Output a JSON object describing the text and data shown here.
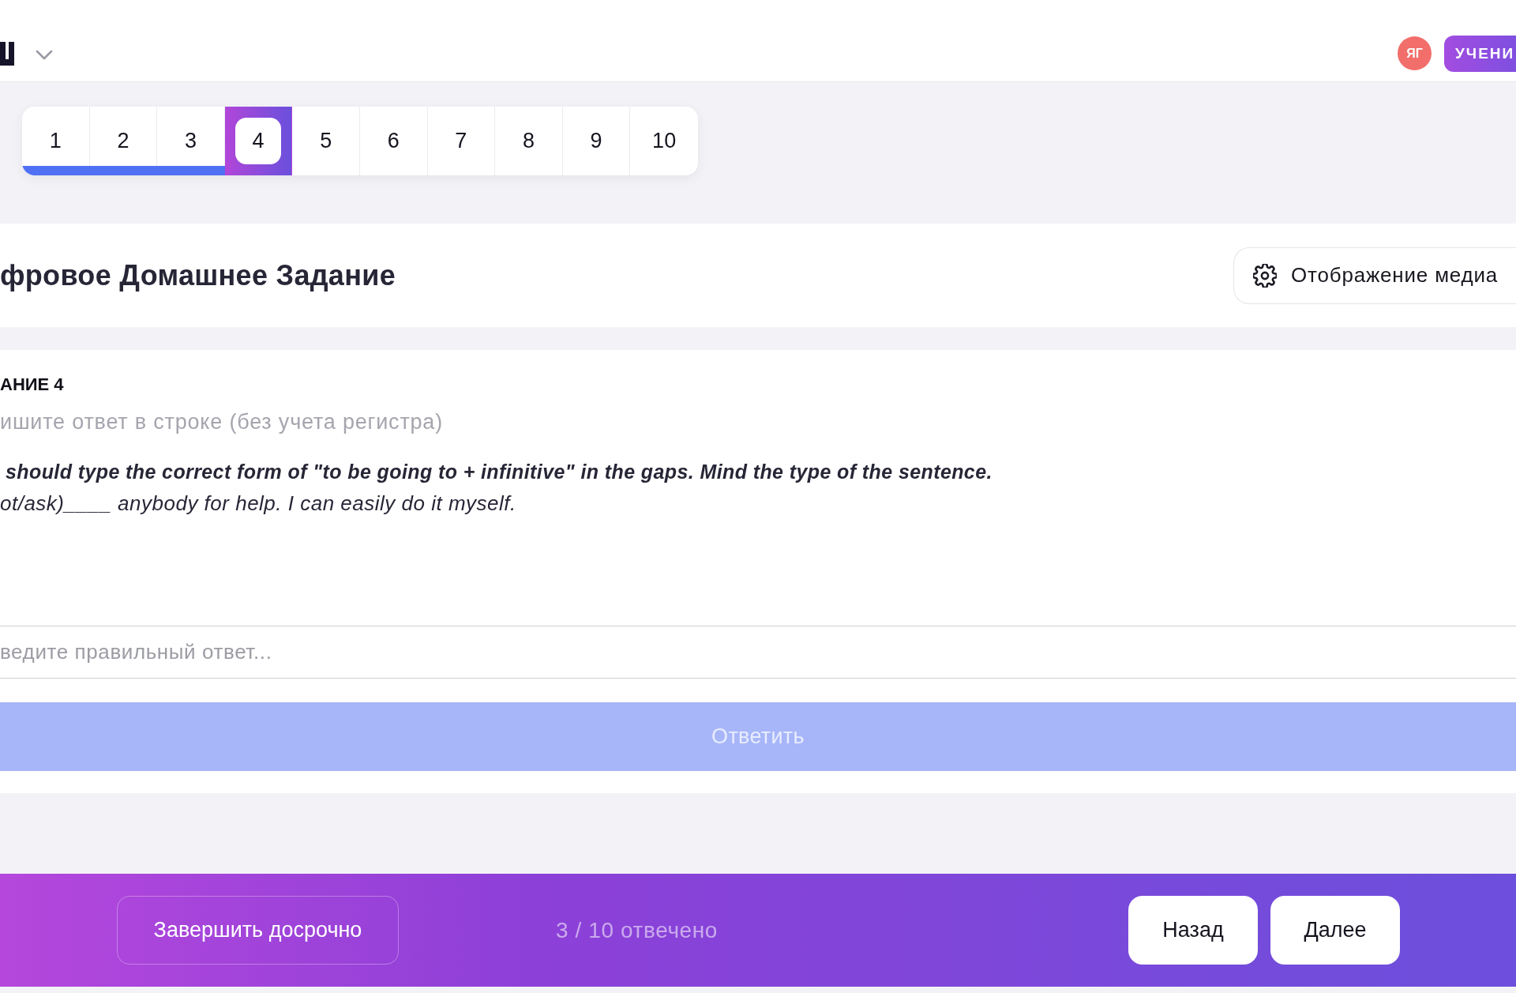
{
  "header": {
    "user": {
      "initials": "ЯГ"
    },
    "role_badge": "УЧЕНИ"
  },
  "questions": [
    {
      "label": "1",
      "answered": true,
      "selected": false
    },
    {
      "label": "2",
      "answered": true,
      "selected": false
    },
    {
      "label": "3",
      "answered": true,
      "selected": false
    },
    {
      "label": "4",
      "answered": false,
      "selected": true
    },
    {
      "label": "5",
      "answered": false,
      "selected": false
    },
    {
      "label": "6",
      "answered": false,
      "selected": false
    },
    {
      "label": "7",
      "answered": false,
      "selected": false
    },
    {
      "label": "8",
      "answered": false,
      "selected": false
    },
    {
      "label": "9",
      "answered": false,
      "selected": false
    },
    {
      "label": "10",
      "answered": false,
      "selected": false
    }
  ],
  "page_title": "фровое Домашнее Задание",
  "media_button": "Отображение медиа",
  "task": {
    "heading": "АНИЕ 4",
    "hint": "ишите ответ в строке (без учета регистра)",
    "instruction": "should type the correct form of \"to be going to + infinitive\" in the gaps. Mind the type of the sentence.",
    "sentence": "ot/ask)____ anybody for help. I can easily do it myself.",
    "answer": {
      "placeholder": "ведите правильный ответ..."
    },
    "submit": {
      "label": "Ответить",
      "disabled": true
    }
  },
  "footer": {
    "finish_button": "Завершить досрочно",
    "progress": "3 / 10 отвечено",
    "buttons": [
      {
        "label": "Назад"
      },
      {
        "label": "Далее"
      }
    ]
  }
}
